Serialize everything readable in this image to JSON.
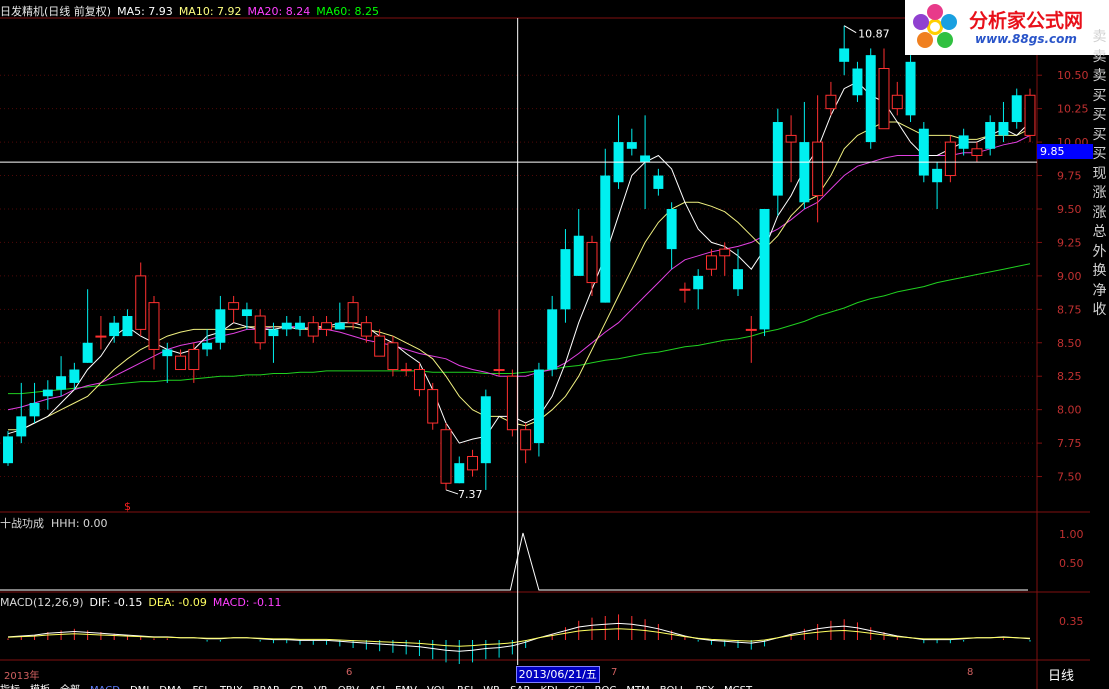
{
  "header": {
    "title": "日发精机(日线 前复权)",
    "ma5": "MA5: 7.93",
    "ma10": "MA10: 7.92",
    "ma20": "MA20: 8.24",
    "ma60": "MA60: 8.25",
    "colors": {
      "title": "#e8e8e8",
      "ma5": "#ffffff",
      "ma10": "#ffff80",
      "ma20": "#ff40ff",
      "ma60": "#00ff00"
    }
  },
  "logo": {
    "text": "分析家公式网",
    "url_text": "www.88gs.com"
  },
  "price_axis": [
    "10.50",
    "10.25",
    "10.00",
    "9.75",
    "9.50",
    "9.25",
    "9.00",
    "8.75",
    "8.50",
    "8.25",
    "8.00",
    "7.75",
    "7.50"
  ],
  "cursor_price": "9.85",
  "high_label": "10.87",
  "low_label": "7.37",
  "signal_marker": "$",
  "side_labels": [
    "卖",
    "卖",
    "卖",
    "买",
    "买",
    "买",
    "买",
    "现",
    "涨",
    "涨",
    "总",
    "外",
    "换",
    "净",
    "收"
  ],
  "indicator": {
    "title": "十战功成",
    "value": "HHH: 0.00",
    "axis": [
      "1.00",
      "0.50"
    ]
  },
  "macd": {
    "title": "MACD(12,26,9)",
    "dif": "DIF: -0.15",
    "dea": "DEA: -0.09",
    "macd": "MACD: -0.11",
    "axis": [
      "0.35"
    ]
  },
  "date_axis": [
    "2013年",
    "6",
    "7",
    "8"
  ],
  "cursor_date": "2013/06/21/五",
  "period_label": "日线",
  "bottom_tabs": [
    "指标",
    "模板",
    "全部",
    "MACD",
    "DMI",
    "DMA",
    "FSL",
    "TRIX",
    "BRAR",
    "CR",
    "VR",
    "OBV",
    "ASI",
    "EMV",
    "VOL",
    "RSI",
    "WR",
    "SAR",
    "KDJ",
    "CCI",
    "ROC",
    "MTM",
    "BOLL",
    "PSY",
    "MCST"
  ],
  "chart_data": {
    "type": "candlestick",
    "ylim": [
      7.25,
      10.95
    ],
    "candles": [
      [
        7.8,
        7.6,
        7.84,
        7.58
      ],
      [
        7.95,
        7.8,
        8.2,
        7.75
      ],
      [
        8.05,
        7.95,
        8.2,
        7.9
      ],
      [
        8.15,
        8.1,
        8.22,
        8.0
      ],
      [
        8.25,
        8.15,
        8.4,
        8.1
      ],
      [
        8.3,
        8.2,
        8.35,
        8.15
      ],
      [
        8.5,
        8.35,
        8.9,
        8.35
      ],
      [
        8.55,
        8.55,
        8.7,
        8.45
      ],
      [
        8.65,
        8.55,
        8.7,
        8.5
      ],
      [
        8.7,
        8.55,
        8.75,
        8.55
      ],
      [
        8.6,
        9.0,
        9.1,
        8.55
      ],
      [
        8.45,
        8.8,
        8.85,
        8.3
      ],
      [
        8.45,
        8.4,
        8.5,
        8.2
      ],
      [
        8.3,
        8.4,
        8.45,
        8.3
      ],
      [
        8.3,
        8.45,
        8.5,
        8.2
      ],
      [
        8.5,
        8.45,
        8.6,
        8.4
      ],
      [
        8.75,
        8.5,
        8.85,
        8.45
      ],
      [
        8.75,
        8.8,
        8.85,
        8.65
      ],
      [
        8.75,
        8.7,
        8.8,
        8.6
      ],
      [
        8.5,
        8.7,
        8.75,
        8.45
      ],
      [
        8.6,
        8.55,
        8.65,
        8.35
      ],
      [
        8.65,
        8.6,
        8.7,
        8.55
      ],
      [
        8.65,
        8.6,
        8.7,
        8.55
      ],
      [
        8.55,
        8.65,
        8.7,
        8.5
      ],
      [
        8.6,
        8.65,
        8.7,
        8.55
      ],
      [
        8.65,
        8.6,
        8.8,
        8.6
      ],
      [
        8.65,
        8.8,
        8.85,
        8.6
      ],
      [
        8.55,
        8.65,
        8.7,
        8.5
      ],
      [
        8.4,
        8.55,
        8.6,
        8.4
      ],
      [
        8.3,
        8.5,
        8.55,
        8.25
      ],
      [
        8.3,
        8.3,
        8.35,
        8.25
      ],
      [
        8.15,
        8.3,
        8.35,
        8.1
      ],
      [
        7.9,
        8.15,
        8.2,
        7.85
      ],
      [
        7.45,
        7.85,
        7.9,
        7.4
      ],
      [
        7.6,
        7.45,
        7.65,
        7.45
      ],
      [
        7.55,
        7.65,
        7.7,
        7.5
      ],
      [
        8.1,
        7.6,
        8.15,
        7.4
      ],
      [
        8.3,
        8.3,
        8.75,
        8.25
      ],
      [
        7.85,
        8.25,
        8.3,
        7.8
      ],
      [
        7.7,
        7.85,
        7.9,
        7.6
      ],
      [
        8.3,
        7.75,
        8.35,
        7.65
      ],
      [
        8.75,
        8.3,
        8.85,
        8.25
      ],
      [
        9.2,
        8.75,
        9.35,
        8.65
      ],
      [
        9.3,
        9.0,
        9.5,
        9.0
      ],
      [
        8.95,
        9.25,
        9.3,
        8.85
      ],
      [
        9.75,
        8.8,
        9.95,
        8.8
      ],
      [
        10.0,
        9.7,
        10.2,
        9.65
      ],
      [
        10.0,
        9.95,
        10.1,
        9.9
      ],
      [
        9.9,
        9.85,
        10.2,
        9.5
      ],
      [
        9.75,
        9.65,
        9.8,
        9.6
      ],
      [
        9.5,
        9.2,
        9.55,
        9.05
      ],
      [
        8.9,
        8.9,
        8.95,
        8.8
      ],
      [
        9.0,
        8.9,
        9.05,
        8.75
      ],
      [
        9.05,
        9.15,
        9.2,
        9.0
      ],
      [
        9.15,
        9.2,
        9.25,
        9.0
      ],
      [
        9.05,
        8.9,
        9.2,
        8.85
      ],
      [
        8.6,
        8.6,
        8.7,
        8.35
      ],
      [
        9.5,
        8.6,
        9.5,
        8.55
      ],
      [
        10.15,
        9.6,
        10.25,
        9.45
      ],
      [
        10.0,
        10.05,
        10.2,
        9.7
      ],
      [
        10.0,
        9.55,
        10.3,
        9.5
      ],
      [
        9.6,
        10.0,
        10.35,
        9.4
      ],
      [
        10.25,
        10.35,
        10.45,
        10.2
      ],
      [
        10.7,
        10.6,
        10.87,
        10.5
      ],
      [
        10.55,
        10.35,
        10.6,
        10.3
      ],
      [
        10.65,
        10.0,
        10.7,
        9.95
      ],
      [
        10.1,
        10.55,
        10.7,
        10.1
      ],
      [
        10.25,
        10.35,
        10.45,
        10.2
      ],
      [
        10.6,
        10.2,
        10.65,
        10.15
      ],
      [
        10.1,
        9.75,
        10.15,
        9.7
      ],
      [
        9.8,
        9.7,
        9.85,
        9.5
      ],
      [
        9.75,
        10.0,
        10.05,
        9.7
      ],
      [
        10.05,
        9.95,
        10.1,
        9.9
      ],
      [
        9.9,
        9.95,
        10.0,
        9.85
      ],
      [
        10.15,
        9.95,
        10.2,
        9.9
      ],
      [
        10.15,
        10.05,
        10.3,
        10.0
      ],
      [
        10.35,
        10.15,
        10.4,
        10.1
      ],
      [
        10.05,
        10.35,
        10.4,
        10.0
      ]
    ],
    "ma5": [
      7.82,
      7.85,
      7.9,
      7.95,
      8.05,
      8.15,
      8.3,
      8.4,
      8.55,
      8.62,
      8.55,
      8.5,
      8.45,
      8.42,
      8.45,
      8.55,
      8.58,
      8.65,
      8.62,
      8.6,
      8.6,
      8.62,
      8.6,
      8.62,
      8.62,
      8.65,
      8.65,
      8.62,
      8.55,
      8.5,
      8.42,
      8.35,
      8.15,
      7.9,
      7.75,
      7.78,
      7.8,
      7.95,
      7.95,
      7.9,
      7.95,
      8.1,
      8.35,
      8.65,
      8.9,
      9.15,
      9.45,
      9.75,
      9.85,
      9.9,
      9.8,
      9.55,
      9.35,
      9.25,
      9.22,
      9.15,
      9.05,
      9.2,
      9.45,
      9.6,
      9.8,
      9.95,
      10.2,
      10.4,
      10.45,
      10.35,
      10.3,
      10.15,
      10.0,
      9.9,
      9.9,
      9.95,
      10.0,
      10.0,
      10.05,
      10.1,
      10.05,
      10.15
    ],
    "ma10": [
      7.85,
      7.85,
      7.9,
      7.95,
      8.0,
      8.05,
      8.1,
      8.2,
      8.3,
      8.38,
      8.45,
      8.5,
      8.55,
      8.58,
      8.6,
      8.6,
      8.6,
      8.6,
      8.62,
      8.62,
      8.62,
      8.62,
      8.6,
      8.6,
      8.62,
      8.62,
      8.62,
      8.6,
      8.58,
      8.55,
      8.5,
      8.45,
      8.38,
      8.25,
      8.1,
      8.0,
      7.95,
      7.95,
      7.9,
      7.88,
      7.92,
      8.0,
      8.1,
      8.25,
      8.45,
      8.65,
      8.85,
      9.05,
      9.25,
      9.4,
      9.5,
      9.55,
      9.55,
      9.52,
      9.48,
      9.4,
      9.3,
      9.2,
      9.3,
      9.45,
      9.55,
      9.6,
      9.75,
      9.95,
      10.05,
      10.1,
      10.15,
      10.15,
      10.1,
      10.05,
      10.05,
      10.05,
      10.02,
      10.02,
      10.05,
      10.05,
      10.05,
      10.1
    ],
    "ma20": [
      8.0,
      8.02,
      8.05,
      8.08,
      8.1,
      8.15,
      8.18,
      8.2,
      8.25,
      8.3,
      8.35,
      8.4,
      8.45,
      8.48,
      8.5,
      8.52,
      8.55,
      8.57,
      8.6,
      8.6,
      8.62,
      8.62,
      8.62,
      8.6,
      8.6,
      8.58,
      8.55,
      8.52,
      8.5,
      8.48,
      8.45,
      8.42,
      8.4,
      8.38,
      8.33,
      8.3,
      8.28,
      8.25,
      8.25,
      8.25,
      8.28,
      8.3,
      8.35,
      8.42,
      8.5,
      8.58,
      8.65,
      8.75,
      8.85,
      8.95,
      9.05,
      9.12,
      9.15,
      9.18,
      9.2,
      9.22,
      9.25,
      9.3,
      9.35,
      9.42,
      9.5,
      9.55,
      9.65,
      9.75,
      9.82,
      9.85,
      9.88,
      9.9,
      9.9,
      9.9,
      9.9,
      9.9,
      9.92,
      9.92,
      9.95,
      9.98,
      10.0,
      10.05
    ],
    "ma60": [
      8.12,
      8.12,
      8.13,
      8.14,
      8.15,
      8.16,
      8.17,
      8.18,
      8.19,
      8.2,
      8.21,
      8.21,
      8.22,
      8.22,
      8.23,
      8.24,
      8.25,
      8.25,
      8.26,
      8.26,
      8.27,
      8.27,
      8.28,
      8.28,
      8.29,
      8.29,
      8.29,
      8.29,
      8.29,
      8.29,
      8.29,
      8.29,
      8.28,
      8.28,
      8.28,
      8.28,
      8.27,
      8.27,
      8.27,
      8.28,
      8.29,
      8.3,
      8.32,
      8.33,
      8.35,
      8.37,
      8.38,
      8.4,
      8.42,
      8.43,
      8.45,
      8.47,
      8.48,
      8.5,
      8.52,
      8.53,
      8.55,
      8.58,
      8.6,
      8.63,
      8.66,
      8.7,
      8.73,
      8.76,
      8.8,
      8.83,
      8.85,
      8.88,
      8.9,
      8.92,
      8.95,
      8.97,
      8.99,
      9.01,
      9.03,
      9.05,
      9.07,
      9.09
    ],
    "hhh_spike_index": 38,
    "macd_hist": [
      0.01,
      0.02,
      0.03,
      0.05,
      0.06,
      0.07,
      0.06,
      0.05,
      0.04,
      0.03,
      0.02,
      0.01,
      0.01,
      0.0,
      0.0,
      -0.01,
      -0.01,
      0.0,
      0.0,
      -0.01,
      -0.02,
      -0.02,
      -0.03,
      -0.03,
      -0.03,
      -0.04,
      -0.05,
      -0.06,
      -0.07,
      -0.08,
      -0.09,
      -0.1,
      -0.12,
      -0.14,
      -0.15,
      -0.14,
      -0.12,
      -0.11,
      -0.09,
      -0.05,
      0.0,
      0.04,
      0.08,
      0.12,
      0.14,
      0.15,
      0.16,
      0.15,
      0.13,
      0.1,
      0.06,
      0.02,
      -0.01,
      -0.03,
      -0.04,
      -0.05,
      -0.06,
      -0.04,
      0.0,
      0.04,
      0.07,
      0.1,
      0.12,
      0.13,
      0.11,
      0.08,
      0.05,
      0.02,
      0.0,
      -0.02,
      -0.02,
      -0.02,
      -0.01,
      0.0,
      0.0,
      0.01,
      0.0,
      -0.01
    ]
  }
}
